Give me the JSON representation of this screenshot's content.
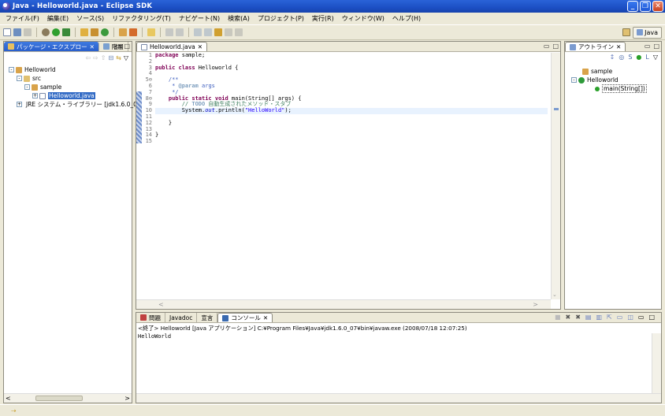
{
  "window": {
    "title": "Java - Helloworld.java - Eclipse SDK"
  },
  "menu": [
    "ファイル(F)",
    "編集(E)",
    "ソース(S)",
    "リファクタリング(T)",
    "ナビゲート(N)",
    "検索(A)",
    "プロジェクト(P)",
    "実行(R)",
    "ウィンドウ(W)",
    "ヘルプ(H)"
  ],
  "perspective": {
    "label": "Java"
  },
  "explorer": {
    "tabs": [
      "パッケージ・エクスプロー",
      "階層"
    ],
    "tree": [
      {
        "label": "Helloworld",
        "indent": 1,
        "icon": "project-icon",
        "exp": "⊟"
      },
      {
        "label": "src",
        "indent": 2,
        "icon": "src-folder-icon",
        "exp": "⊟"
      },
      {
        "label": "sample",
        "indent": 3,
        "icon": "package-icon",
        "exp": "⊟"
      },
      {
        "label": "Helloworld.java",
        "indent": 4,
        "icon": "java-file-icon",
        "exp": "⊞",
        "selected": true
      },
      {
        "label": "JRE システム・ライブラリー [jdk1.6.0_07]",
        "indent": 2,
        "icon": "library-icon",
        "exp": "⊞"
      }
    ]
  },
  "editor": {
    "tab": "Helloworld.java",
    "lines": [
      [
        {
          "t": "package",
          "c": "kw"
        },
        {
          "t": " sample;"
        }
      ],
      [],
      [
        {
          "t": "public class",
          "c": "kw"
        },
        {
          "t": " Helloworld {"
        }
      ],
      [],
      [
        {
          "t": "    /**",
          "c": "jd"
        }
      ],
      [
        {
          "t": "     * ",
          "c": "jd"
        },
        {
          "t": "@param",
          "c": "jt"
        },
        {
          "t": " args",
          "c": "jd"
        }
      ],
      [
        {
          "t": "     */",
          "c": "jd"
        }
      ],
      [
        {
          "t": "    "
        },
        {
          "t": "public static void",
          "c": "kw"
        },
        {
          "t": " main(String[] args) {"
        }
      ],
      [
        {
          "t": "        // ",
          "c": "cm"
        },
        {
          "t": "TODO",
          "c": "jt"
        },
        {
          "t": " 自動生成されたメソッド・スタブ",
          "c": "cm"
        }
      ],
      [
        {
          "t": "        System."
        },
        {
          "t": "out",
          "c": "fld"
        },
        {
          "t": ".println("
        },
        {
          "t": "\"HelloWorld\"",
          "c": "st"
        },
        {
          "t": ");"
        }
      ],
      [],
      [
        {
          "t": "    }"
        }
      ],
      [],
      [
        {
          "t": "}"
        }
      ],
      []
    ],
    "line_numbers": [
      "1",
      "2",
      "3",
      "4",
      "5⊖",
      "6",
      "7",
      "8⊖",
      "9",
      "10",
      "11",
      "12",
      "13",
      "14",
      "15"
    ]
  },
  "outline": {
    "tab": "アウトライン",
    "items": [
      {
        "label": "sample",
        "icon": "package-icon"
      },
      {
        "label": "Helloworld",
        "icon": "class-icon"
      },
      {
        "label": "main(String[])",
        "icon": "method-icon"
      }
    ]
  },
  "console": {
    "tabs": [
      "問題",
      "Javadoc",
      "宣言",
      "コンソール"
    ],
    "info": "<終了> Helloworld [Java アプリケーション] C:¥Program Files¥Java¥jdk1.6.0_07¥bin¥javaw.exe (2008/07/18 12:07:25)",
    "output": "HelloWorld"
  },
  "colors": {
    "title_bar": "#2a63d8",
    "keyword": "#7f0055",
    "comment": "#3f7f5f",
    "string": "#2a00ff",
    "selection": "#316ac5"
  }
}
